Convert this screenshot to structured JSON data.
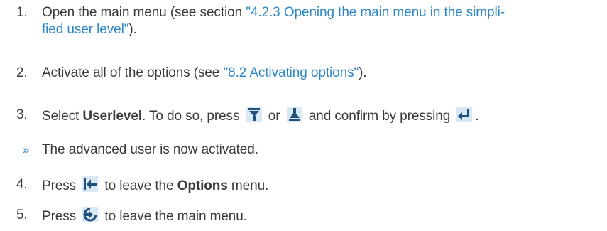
{
  "steps": [
    {
      "number": "1.",
      "pre": "Open the main menu (see section ",
      "link": "\"4.2.3 Opening the main menu in the simpli-",
      "link2": "fied user level\"",
      "post": ")."
    },
    {
      "number": "2.",
      "pre": "Activate all of the options (see ",
      "link": "\"8.2 Activating options\"",
      "post": ")."
    },
    {
      "number": "3.",
      "pre": "Select ",
      "bold": "Userlevel",
      "mid1": ". To do so, press ",
      "mid2": " or ",
      "mid3": " and confirm by pressing ",
      "post": "."
    },
    {
      "marker": "»",
      "text": "The advanced user is now activated."
    },
    {
      "number": "4.",
      "pre": "Press ",
      "mid": " to leave the ",
      "bold": "Options",
      "post": " menu."
    },
    {
      "number": "5.",
      "pre": "Press ",
      "post": " to leave the main menu."
    }
  ],
  "icons": {
    "down": "down-arrow-icon",
    "up": "up-arrow-icon",
    "enter": "enter-icon",
    "back": "back-icon",
    "home": "home-exit-icon"
  },
  "colors": {
    "text": "#3a3a3a",
    "link": "#2f86c6",
    "icon_bg": "#d9e8f5",
    "icon_fg": "#1f4f7a"
  }
}
